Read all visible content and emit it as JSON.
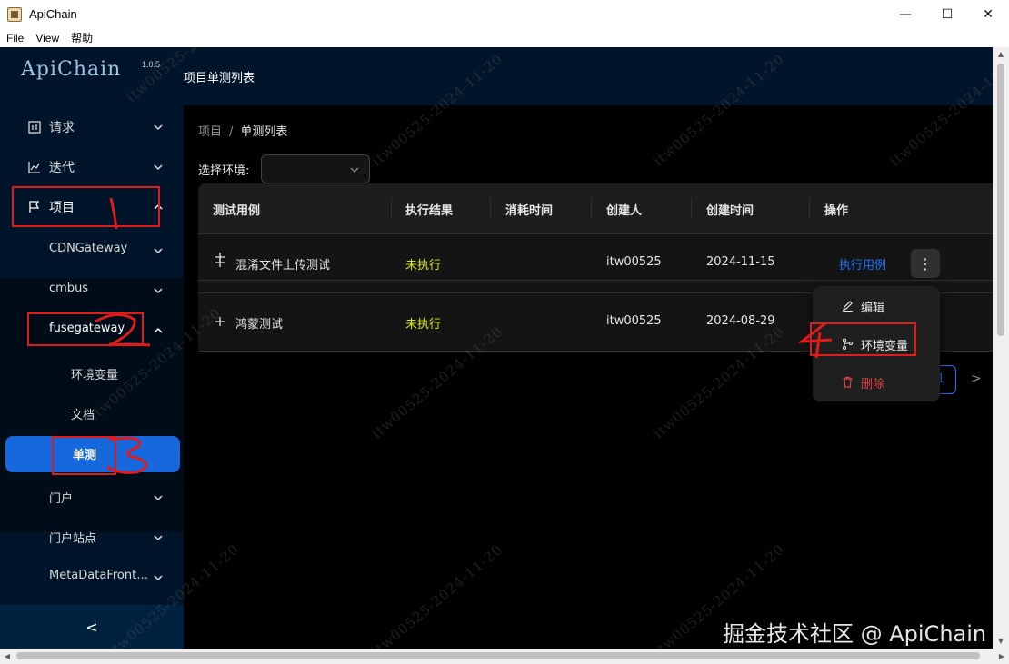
{
  "window": {
    "title": "ApiChain",
    "minimize": "—",
    "maximize": "☐",
    "close": "✕"
  },
  "menubar": {
    "items": [
      "File",
      "View",
      "帮助"
    ]
  },
  "app": {
    "logo": "ApiChain",
    "version": "1.0.5"
  },
  "header": {
    "title": "项目单测列表"
  },
  "sidebar": {
    "items": [
      {
        "label": "请求",
        "icon": "bar-chart-icon"
      },
      {
        "label": "迭代",
        "icon": "line-chart-icon"
      },
      {
        "label": "项目",
        "icon": "flag-icon"
      }
    ],
    "projects": [
      {
        "label": "CDNGateway"
      },
      {
        "label": "cmbus"
      },
      {
        "label": "fusegateway"
      }
    ],
    "fusegateway_children": [
      {
        "label": "环境变量"
      },
      {
        "label": "文档"
      },
      {
        "label": "单测"
      }
    ],
    "more_projects": [
      {
        "label": "门户"
      },
      {
        "label": "门户站点"
      },
      {
        "label": "MetaDataFront…"
      }
    ],
    "collapse": "<"
  },
  "breadcrumb": {
    "root": "项目",
    "sep": "/",
    "current": "单测列表"
  },
  "env_select": {
    "label": "选择环境:",
    "value": ""
  },
  "table": {
    "columns": [
      "测试用例",
      "执行结果",
      "消耗时间",
      "创建人",
      "创建时间",
      "操作"
    ],
    "rows": [
      {
        "name": "混淆文件上传测试",
        "result": "未执行",
        "duration": "",
        "creator": "itw00525",
        "created": "2024-11-15",
        "action": "执行用例"
      },
      {
        "name": "鸿蒙测试",
        "result": "未执行",
        "duration": "",
        "creator": "itw00525",
        "created": "2024-08-29",
        "action": ""
      }
    ],
    "more": "⋮",
    "expand": "+"
  },
  "pagination": {
    "current": "1",
    "next": ">"
  },
  "dropdown": {
    "items": [
      {
        "label": "编辑",
        "icon": "edit-icon"
      },
      {
        "label": "环境变量",
        "icon": "branch-icon"
      },
      {
        "label": "删除",
        "icon": "delete-icon"
      }
    ]
  },
  "watermark": "itw00525-2024-11-20",
  "credit": "掘金技术社区 @ ApiChain",
  "colors": {
    "sidebar": "#001529",
    "accent": "#1677ff",
    "warn": "#d8e80f",
    "danger": "#dc4446",
    "annotation": "#e01b1b"
  }
}
